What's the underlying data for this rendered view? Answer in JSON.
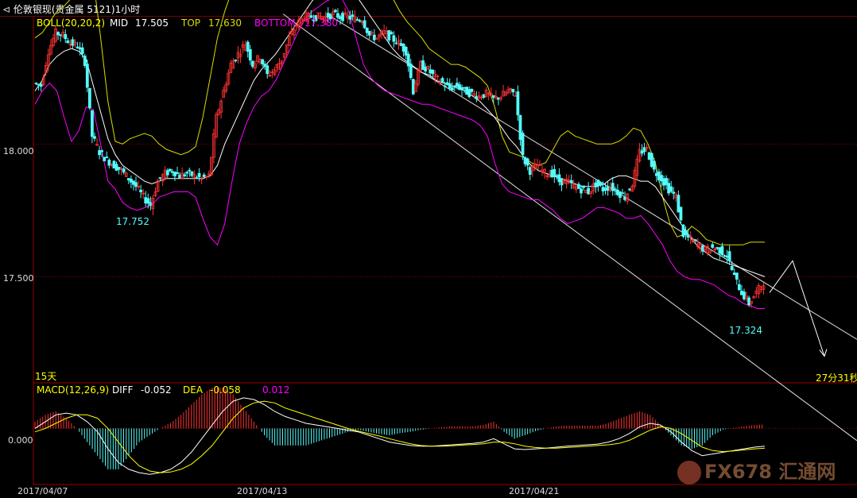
{
  "window": {
    "title": "伦敦银现(贵金属 5121)1小时",
    "back_icon": "back-arrow-icon"
  },
  "indicator_boll": {
    "name": "BOLL(20,20,2)",
    "mid_label": "MID",
    "mid_value": "17.505",
    "top_label": "TOP",
    "top_value": "17.630",
    "bottom_label": "BOTTOM",
    "bottom_value": "17.380"
  },
  "indicator_macd": {
    "name": "MACD(12,26,9)",
    "diff_label": "DIFF",
    "diff_value": "-0.052",
    "dea_label": "DEA",
    "dea_value": "-0.058",
    "macd_value": "0.012"
  },
  "main_panel": {
    "period_label": "15天",
    "countdown": "27分31秒"
  },
  "watermark": {
    "text": "FX678 汇通网"
  },
  "colors": {
    "up": "#ff3232",
    "down": "#54fcfc",
    "mid": "#ffffff",
    "top": "#dcdc00",
    "bottom": "#ff00ff",
    "grid": "#8b0000",
    "label_yellow": "#ffff00",
    "label_cyan": "#54fcfc",
    "diff_line": "#ffffff",
    "dea_line": "#ffff00"
  },
  "chart_data": [
    {
      "type": "candlestick",
      "title": "伦敦银现(贵金属 5121)1小时",
      "y_ticks": [
        "18.000",
        "17.500"
      ],
      "x_ticks": [
        "2017/04/07",
        "2017/04/13",
        "2017/04/21"
      ],
      "ylim": [
        17.1,
        18.48
      ],
      "annotations": [
        {
          "text": "17.752",
          "value": 17.752,
          "kind": "low"
        },
        {
          "text": "17.324",
          "value": 17.324,
          "kind": "low"
        }
      ],
      "price_path": [
        18.23,
        18.22,
        18.35,
        18.42,
        18.41,
        18.38,
        18.37,
        18.31,
        18.03,
        17.97,
        17.94,
        17.92,
        17.9,
        17.87,
        17.84,
        17.8,
        17.77,
        17.86,
        17.89,
        17.9,
        17.88,
        17.89,
        17.88,
        17.87,
        17.88,
        18.1,
        18.2,
        18.3,
        18.34,
        18.38,
        18.3,
        18.33,
        18.26,
        18.28,
        18.32,
        18.4,
        18.45,
        18.48,
        18.48,
        18.48,
        18.48,
        18.49,
        18.48,
        18.48,
        18.47,
        18.47,
        18.41,
        18.4,
        18.42,
        18.4,
        18.38,
        18.35,
        18.2,
        18.3,
        18.28,
        18.25,
        18.23,
        18.21,
        18.22,
        18.2,
        18.19,
        18.18,
        18.19,
        18.17,
        18.18,
        18.2,
        18.19,
        17.95,
        17.9,
        17.92,
        17.89,
        17.89,
        17.86,
        17.86,
        17.84,
        17.83,
        17.82,
        17.85,
        17.83,
        17.84,
        17.82,
        17.8,
        17.85,
        17.97,
        17.98,
        17.9,
        17.87,
        17.83,
        17.8,
        17.66,
        17.64,
        17.62,
        17.6,
        17.61,
        17.6,
        17.58,
        17.5,
        17.44,
        17.4,
        17.44,
        17.48
      ],
      "boll_mid": [
        18.2,
        18.24,
        18.3,
        18.33,
        18.35,
        18.36,
        18.35,
        18.32,
        18.22,
        18.12,
        18.02,
        17.96,
        17.92,
        17.9,
        17.88,
        17.86,
        17.85,
        17.86,
        17.87,
        17.87,
        17.87,
        17.87,
        17.87,
        17.87,
        17.88,
        17.92,
        18.0,
        18.06,
        18.12,
        18.18,
        18.24,
        18.28,
        18.31,
        18.34,
        18.38,
        18.42,
        18.46,
        18.5,
        18.54,
        18.57,
        18.59,
        18.6,
        18.61,
        18.59,
        18.56,
        18.52,
        18.48,
        18.44,
        18.4,
        18.36,
        18.33,
        18.31,
        18.29,
        18.27,
        18.26,
        18.24,
        18.23,
        18.22,
        18.21,
        18.2,
        18.18,
        18.16,
        18.13,
        18.1,
        18.06,
        18.02,
        17.99,
        17.95,
        17.92,
        17.9,
        17.89,
        17.88,
        17.87,
        17.86,
        17.85,
        17.84,
        17.84,
        17.84,
        17.85,
        17.87,
        17.88,
        17.88,
        17.87,
        17.86,
        17.86,
        17.84,
        17.8,
        17.76,
        17.72,
        17.68,
        17.64,
        17.61,
        17.59,
        17.57,
        17.56,
        17.55,
        17.54,
        17.53,
        17.52,
        17.51,
        17.5
      ],
      "boll_top": [
        18.4,
        18.42,
        18.46,
        18.5,
        18.52,
        18.55,
        18.65,
        18.7,
        18.62,
        18.4,
        18.16,
        18.01,
        18.0,
        18.02,
        18.03,
        18.04,
        18.03,
        18.0,
        17.98,
        17.97,
        17.96,
        17.97,
        17.99,
        18.1,
        18.25,
        18.4,
        18.5,
        18.58,
        18.62,
        18.65,
        18.66,
        18.66,
        18.66,
        18.67,
        18.68,
        18.7,
        18.72,
        18.73,
        18.73,
        18.74,
        18.75,
        18.76,
        18.76,
        18.75,
        18.74,
        18.73,
        18.72,
        18.7,
        18.62,
        18.55,
        18.5,
        18.46,
        18.43,
        18.4,
        18.36,
        18.34,
        18.32,
        18.3,
        18.3,
        18.29,
        18.27,
        18.25,
        18.22,
        18.14,
        18.03,
        17.97,
        17.96,
        17.95,
        17.93,
        17.92,
        17.93,
        17.98,
        18.03,
        18.05,
        18.03,
        18.02,
        18.01,
        18.0,
        18.0,
        18.0,
        18.01,
        18.03,
        18.06,
        18.05,
        18.0,
        17.93,
        17.8,
        17.7,
        17.65,
        17.66,
        17.69,
        17.67,
        17.64,
        17.63,
        17.62,
        17.62,
        17.62,
        17.62,
        17.63,
        17.63,
        17.63
      ],
      "boll_bottom": [
        18.15,
        18.2,
        18.23,
        18.2,
        18.1,
        18.01,
        18.05,
        18.14,
        18.13,
        18.0,
        17.86,
        17.83,
        17.78,
        17.76,
        17.75,
        17.76,
        17.77,
        17.8,
        17.81,
        17.82,
        17.82,
        17.82,
        17.8,
        17.72,
        17.65,
        17.62,
        17.7,
        17.86,
        18.0,
        18.08,
        18.14,
        18.18,
        18.2,
        18.24,
        18.3,
        18.36,
        18.42,
        18.47,
        18.5,
        18.52,
        18.54,
        18.55,
        18.55,
        18.5,
        18.4,
        18.3,
        18.25,
        18.22,
        18.2,
        18.19,
        18.18,
        18.17,
        18.16,
        18.15,
        18.15,
        18.14,
        18.13,
        18.12,
        18.11,
        18.1,
        18.09,
        18.07,
        18.03,
        17.93,
        17.85,
        17.82,
        17.81,
        17.8,
        17.79,
        17.79,
        17.77,
        17.75,
        17.72,
        17.7,
        17.71,
        17.72,
        17.74,
        17.76,
        17.76,
        17.75,
        17.74,
        17.72,
        17.72,
        17.73,
        17.7,
        17.66,
        17.62,
        17.56,
        17.52,
        17.5,
        17.49,
        17.49,
        17.48,
        17.47,
        17.45,
        17.43,
        17.42,
        17.4,
        17.39,
        17.38,
        17.38
      ],
      "channel_upper": [
        {
          "date_index": 40,
          "value": 18.49
        },
        {
          "date_index": 101,
          "value": 17.46
        }
      ],
      "channel_lower": [
        {
          "date_index": 34,
          "value": 18.49
        },
        {
          "date_index": 101,
          "value": 17.12
        }
      ],
      "forecast_path": [
        17.44,
        17.56,
        17.2
      ]
    },
    {
      "type": "bar",
      "title": "MACD(12,26,9)",
      "y_ticks": [
        "0.000"
      ],
      "ylim": [
        -0.16,
        0.12
      ],
      "series": [
        {
          "name": "DIFF",
          "values": [
            0.0,
            0.02,
            0.04,
            0.045,
            0.04,
            0.02,
            -0.01,
            -0.06,
            -0.1,
            -0.12,
            -0.13,
            -0.135,
            -0.13,
            -0.12,
            -0.1,
            -0.07,
            -0.03,
            0.01,
            0.05,
            0.08,
            0.09,
            0.085,
            0.07,
            0.05,
            0.035,
            0.025,
            0.015,
            0.01,
            0.005,
            0.0,
            -0.005,
            -0.01,
            -0.02,
            -0.03,
            -0.04,
            -0.045,
            -0.05,
            -0.052,
            -0.052,
            -0.05,
            -0.048,
            -0.046,
            -0.044,
            -0.04,
            -0.03,
            -0.045,
            -0.06,
            -0.062,
            -0.06,
            -0.058,
            -0.055,
            -0.052,
            -0.05,
            -0.048,
            -0.046,
            -0.04,
            -0.03,
            -0.015,
            0.005,
            0.015,
            0.01,
            -0.01,
            -0.04,
            -0.065,
            -0.08,
            -0.075,
            -0.07,
            -0.065,
            -0.06,
            -0.055,
            -0.052
          ]
        },
        {
          "name": "DEA",
          "values": [
            -0.01,
            0.0,
            0.015,
            0.03,
            0.04,
            0.04,
            0.03,
            0.0,
            -0.04,
            -0.08,
            -0.11,
            -0.125,
            -0.13,
            -0.128,
            -0.12,
            -0.105,
            -0.08,
            -0.05,
            -0.01,
            0.03,
            0.06,
            0.075,
            0.08,
            0.075,
            0.06,
            0.05,
            0.04,
            0.03,
            0.02,
            0.01,
            0.0,
            -0.008,
            -0.015,
            -0.022,
            -0.03,
            -0.038,
            -0.045,
            -0.05,
            -0.052,
            -0.052,
            -0.051,
            -0.049,
            -0.047,
            -0.045,
            -0.04,
            -0.04,
            -0.045,
            -0.052,
            -0.056,
            -0.058,
            -0.058,
            -0.056,
            -0.054,
            -0.052,
            -0.05,
            -0.048,
            -0.044,
            -0.035,
            -0.02,
            -0.005,
            0.005,
            0.0,
            -0.015,
            -0.035,
            -0.055,
            -0.065,
            -0.068,
            -0.066,
            -0.063,
            -0.06,
            -0.058
          ]
        }
      ]
    }
  ]
}
